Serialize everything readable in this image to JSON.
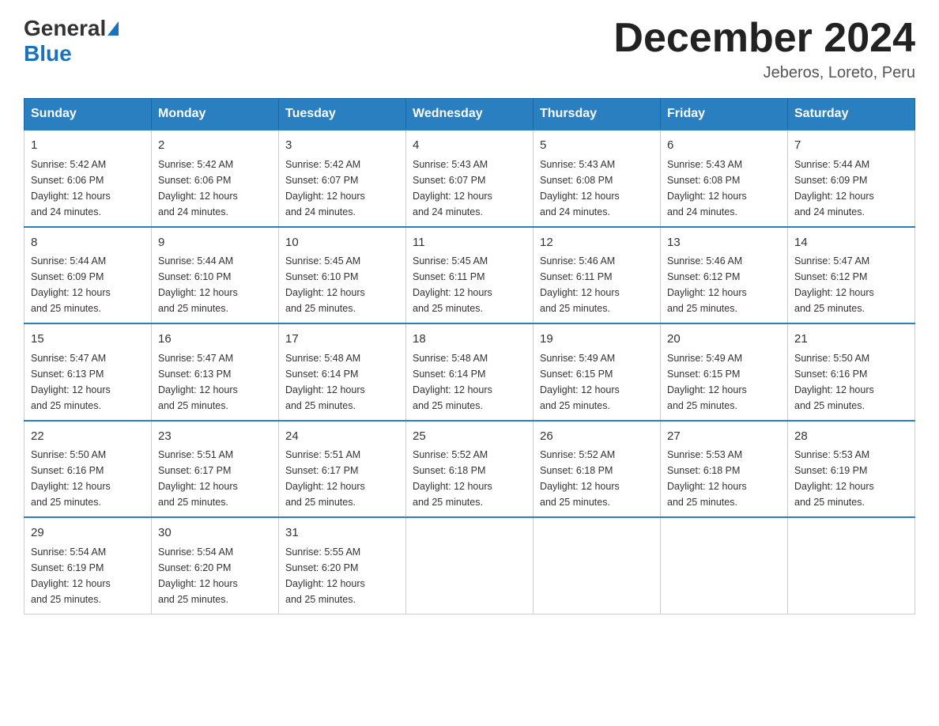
{
  "header": {
    "logo": {
      "general": "General",
      "blue": "Blue"
    },
    "title": "December 2024",
    "subtitle": "Jeberos, Loreto, Peru"
  },
  "days_of_week": [
    "Sunday",
    "Monday",
    "Tuesday",
    "Wednesday",
    "Thursday",
    "Friday",
    "Saturday"
  ],
  "weeks": [
    [
      {
        "day": "1",
        "sunrise": "5:42 AM",
        "sunset": "6:06 PM",
        "daylight": "12 hours and 24 minutes."
      },
      {
        "day": "2",
        "sunrise": "5:42 AM",
        "sunset": "6:06 PM",
        "daylight": "12 hours and 24 minutes."
      },
      {
        "day": "3",
        "sunrise": "5:42 AM",
        "sunset": "6:07 PM",
        "daylight": "12 hours and 24 minutes."
      },
      {
        "day": "4",
        "sunrise": "5:43 AM",
        "sunset": "6:07 PM",
        "daylight": "12 hours and 24 minutes."
      },
      {
        "day": "5",
        "sunrise": "5:43 AM",
        "sunset": "6:08 PM",
        "daylight": "12 hours and 24 minutes."
      },
      {
        "day": "6",
        "sunrise": "5:43 AM",
        "sunset": "6:08 PM",
        "daylight": "12 hours and 24 minutes."
      },
      {
        "day": "7",
        "sunrise": "5:44 AM",
        "sunset": "6:09 PM",
        "daylight": "12 hours and 24 minutes."
      }
    ],
    [
      {
        "day": "8",
        "sunrise": "5:44 AM",
        "sunset": "6:09 PM",
        "daylight": "12 hours and 25 minutes."
      },
      {
        "day": "9",
        "sunrise": "5:44 AM",
        "sunset": "6:10 PM",
        "daylight": "12 hours and 25 minutes."
      },
      {
        "day": "10",
        "sunrise": "5:45 AM",
        "sunset": "6:10 PM",
        "daylight": "12 hours and 25 minutes."
      },
      {
        "day": "11",
        "sunrise": "5:45 AM",
        "sunset": "6:11 PM",
        "daylight": "12 hours and 25 minutes."
      },
      {
        "day": "12",
        "sunrise": "5:46 AM",
        "sunset": "6:11 PM",
        "daylight": "12 hours and 25 minutes."
      },
      {
        "day": "13",
        "sunrise": "5:46 AM",
        "sunset": "6:12 PM",
        "daylight": "12 hours and 25 minutes."
      },
      {
        "day": "14",
        "sunrise": "5:47 AM",
        "sunset": "6:12 PM",
        "daylight": "12 hours and 25 minutes."
      }
    ],
    [
      {
        "day": "15",
        "sunrise": "5:47 AM",
        "sunset": "6:13 PM",
        "daylight": "12 hours and 25 minutes."
      },
      {
        "day": "16",
        "sunrise": "5:47 AM",
        "sunset": "6:13 PM",
        "daylight": "12 hours and 25 minutes."
      },
      {
        "day": "17",
        "sunrise": "5:48 AM",
        "sunset": "6:14 PM",
        "daylight": "12 hours and 25 minutes."
      },
      {
        "day": "18",
        "sunrise": "5:48 AM",
        "sunset": "6:14 PM",
        "daylight": "12 hours and 25 minutes."
      },
      {
        "day": "19",
        "sunrise": "5:49 AM",
        "sunset": "6:15 PM",
        "daylight": "12 hours and 25 minutes."
      },
      {
        "day": "20",
        "sunrise": "5:49 AM",
        "sunset": "6:15 PM",
        "daylight": "12 hours and 25 minutes."
      },
      {
        "day": "21",
        "sunrise": "5:50 AM",
        "sunset": "6:16 PM",
        "daylight": "12 hours and 25 minutes."
      }
    ],
    [
      {
        "day": "22",
        "sunrise": "5:50 AM",
        "sunset": "6:16 PM",
        "daylight": "12 hours and 25 minutes."
      },
      {
        "day": "23",
        "sunrise": "5:51 AM",
        "sunset": "6:17 PM",
        "daylight": "12 hours and 25 minutes."
      },
      {
        "day": "24",
        "sunrise": "5:51 AM",
        "sunset": "6:17 PM",
        "daylight": "12 hours and 25 minutes."
      },
      {
        "day": "25",
        "sunrise": "5:52 AM",
        "sunset": "6:18 PM",
        "daylight": "12 hours and 25 minutes."
      },
      {
        "day": "26",
        "sunrise": "5:52 AM",
        "sunset": "6:18 PM",
        "daylight": "12 hours and 25 minutes."
      },
      {
        "day": "27",
        "sunrise": "5:53 AM",
        "sunset": "6:18 PM",
        "daylight": "12 hours and 25 minutes."
      },
      {
        "day": "28",
        "sunrise": "5:53 AM",
        "sunset": "6:19 PM",
        "daylight": "12 hours and 25 minutes."
      }
    ],
    [
      {
        "day": "29",
        "sunrise": "5:54 AM",
        "sunset": "6:19 PM",
        "daylight": "12 hours and 25 minutes."
      },
      {
        "day": "30",
        "sunrise": "5:54 AM",
        "sunset": "6:20 PM",
        "daylight": "12 hours and 25 minutes."
      },
      {
        "day": "31",
        "sunrise": "5:55 AM",
        "sunset": "6:20 PM",
        "daylight": "12 hours and 25 minutes."
      },
      null,
      null,
      null,
      null
    ]
  ],
  "labels": {
    "sunrise": "Sunrise:",
    "sunset": "Sunset:",
    "daylight": "Daylight:"
  }
}
